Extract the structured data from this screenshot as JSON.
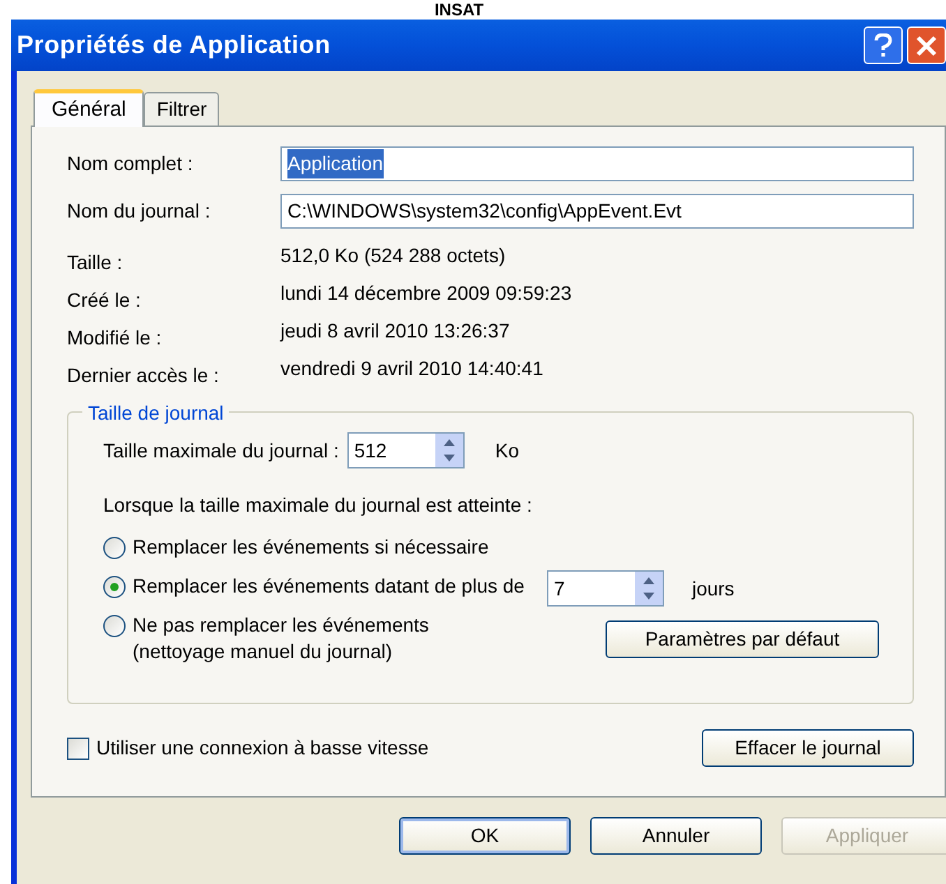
{
  "caption": "INSAT",
  "window": {
    "title": "Propriétés de Application"
  },
  "tabs": [
    {
      "label": "Général",
      "selected": true
    },
    {
      "label": "Filtrer",
      "selected": false
    }
  ],
  "fields": [
    {
      "label": "Nom complet :",
      "value": "Application",
      "text_selected": true
    },
    {
      "label": "Nom du journal :",
      "value": "C:\\WINDOWS\\system32\\config\\AppEvent.Evt",
      "text_selected": false
    }
  ],
  "info": [
    {
      "label": "Taille :",
      "value": "512,0 Ko (524 288 octets)"
    },
    {
      "label": "Créé le :",
      "value": "lundi 14 décembre 2009 09:59:23"
    },
    {
      "label": "Modifié le :",
      "value": "jeudi 8 avril 2010 13:26:37"
    },
    {
      "label": "Dernier accès le :",
      "value": "vendredi 9 avril 2010 14:40:41"
    }
  ],
  "log_size": {
    "title": "Taille de journal",
    "max_label": "Taille maximale du journal :",
    "max_value": "512",
    "unit": "Ko",
    "when_full": "Lorsque la taille maximale du journal est atteinte :",
    "options": [
      {
        "label": "Remplacer les événements si nécessaire",
        "selected": false
      },
      {
        "label": "Remplacer les événements datant de plus de",
        "selected": true,
        "days": "7",
        "days_unit": "jours"
      },
      {
        "label": "Ne pas remplacer les événements",
        "note": "(nettoyage manuel du journal)",
        "selected": false
      }
    ],
    "defaults_button": "Paramètres par défaut"
  },
  "low_speed": {
    "label": "Utiliser une connexion à basse vitesse",
    "checked": false
  },
  "clear_button": "Effacer le journal",
  "buttons": [
    {
      "label": "OK",
      "default": true,
      "disabled": false
    },
    {
      "label": "Annuler",
      "default": false,
      "disabled": false
    },
    {
      "label": "Appliquer",
      "default": false,
      "disabled": true
    }
  ]
}
